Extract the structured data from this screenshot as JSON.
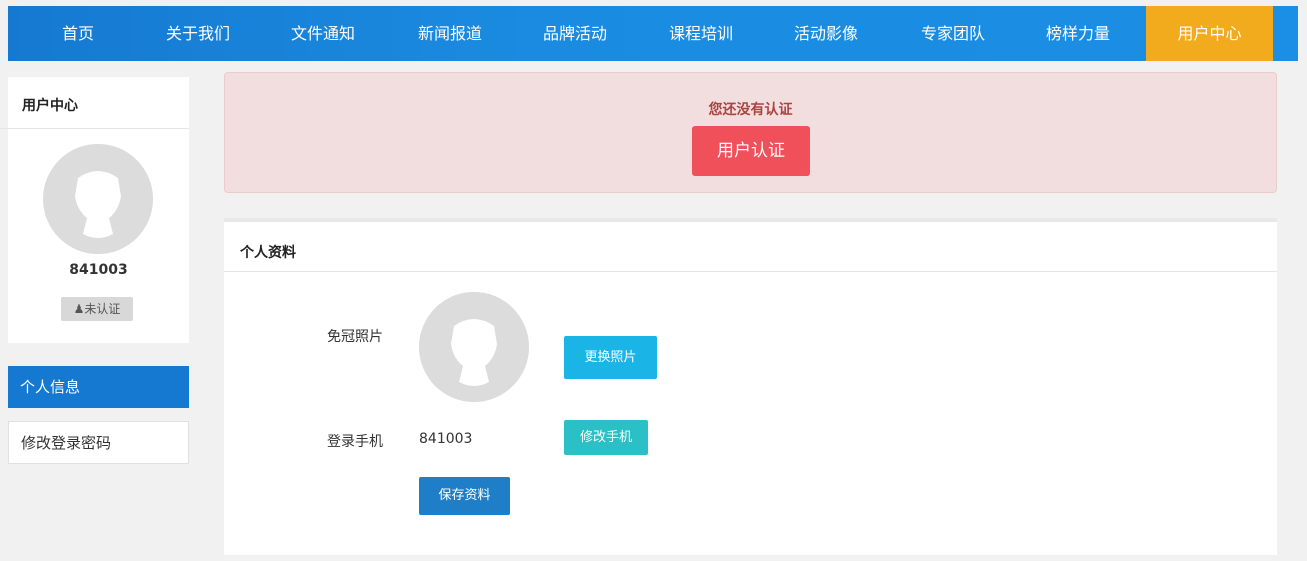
{
  "nav": {
    "items": [
      {
        "label": "首页"
      },
      {
        "label": "关于我们"
      },
      {
        "label": "文件通知"
      },
      {
        "label": "新闻报道"
      },
      {
        "label": "品牌活动"
      },
      {
        "label": "课程培训"
      },
      {
        "label": "活动影像"
      },
      {
        "label": "专家团队"
      },
      {
        "label": "榜样力量"
      },
      {
        "label": "用户中心",
        "active": true
      }
    ]
  },
  "sidebar": {
    "title": "用户中心",
    "username": "841003",
    "badge": "未认证",
    "menu": [
      {
        "label": "个人信息",
        "active": true
      },
      {
        "label": "修改登录密码"
      }
    ]
  },
  "alert": {
    "message": "您还没有认证",
    "button": "用户认证"
  },
  "profile": {
    "title": "个人资料",
    "photo_label": "免冠照片",
    "change_photo": "更换照片",
    "phone_label": "登录手机",
    "phone_value": "841003",
    "change_phone": "修改手机",
    "save": "保存资料"
  },
  "colors": {
    "nav_bg": "#1679d1",
    "nav_active": "#f2ab1c",
    "alert_bg": "#f2dede",
    "alert_text": "#a94442",
    "verify_btn": "#f0505a",
    "photo_btn": "#1ab5e6",
    "phone_btn": "#2bc0c6",
    "save_btn": "#1f7ec8"
  },
  "icons": [
    "user-avatar-icon",
    "user-icon"
  ]
}
